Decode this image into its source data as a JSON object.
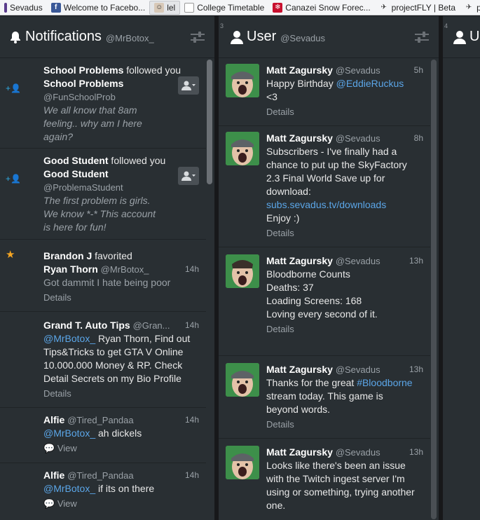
{
  "bookmarks": [
    {
      "label": "Sevadus",
      "icon": "sevadus-icon"
    },
    {
      "label": "Welcome to Facebo...",
      "icon": "facebook-icon"
    },
    {
      "label": "lel",
      "icon": "face-icon"
    },
    {
      "label": "College Timetable",
      "icon": "page-icon"
    },
    {
      "label": "Canazei Snow Forec...",
      "icon": "snow-forecast-icon"
    },
    {
      "label": "projectFLY | Beta",
      "icon": "plane-icon"
    },
    {
      "label": "p",
      "icon": "plane-icon"
    }
  ],
  "columns": {
    "notifications": {
      "title": "Notifications",
      "handle": "@MrBotox_",
      "number": "",
      "items": [
        {
          "type": "follow",
          "actor": "School Problems",
          "action": " followed you",
          "name": "School Problems",
          "handle": "@FunSchoolProb",
          "bio": [
            "We all know that 8am",
            "feeling.. why am I here",
            "again?"
          ]
        },
        {
          "type": "follow",
          "actor": "Good Student",
          "action": " followed you",
          "name": "Good Student",
          "handle": "@ProblemaStudent",
          "bio": [
            "The first problem is girls.",
            "We know *-* This account",
            "is here for fun!"
          ]
        },
        {
          "type": "favorite",
          "actor": "Brandon J",
          "action": " favorited",
          "name": "Ryan Thorn",
          "handle": "@MrBotox_",
          "time": "14h",
          "text": "Got dammit I hate being poor",
          "details": "Details"
        },
        {
          "type": "mention",
          "name": "Grand T. Auto Tips",
          "handle": "@Gran...",
          "time": "14h",
          "mention": "@MrBotox_",
          "lines": [
            " Ryan Thorn, Find out",
            "Tips&Tricks to get GTA V Online",
            "10.000.000 Money & RP. Check",
            "Detail Secrets on my Bio Profile"
          ],
          "details": "Details"
        },
        {
          "type": "reply",
          "name": "Alfie",
          "handle": "@Tired_Pandaa",
          "time": "14h",
          "mention": "@MrBotox_",
          "text": " ah dickels",
          "view": "View"
        },
        {
          "type": "reply",
          "name": "Alfie",
          "handle": "@Tired_Pandaa",
          "time": "14h",
          "mention": "@MrBotox_",
          "text": " if its on there",
          "view": "View"
        }
      ]
    },
    "user": {
      "title": "User",
      "handle": "@Sevadus",
      "number": "3",
      "tweets": [
        {
          "name": "Matt Zagursky",
          "handle": "@Sevadus",
          "time": "5h",
          "lines": [
            {
              "pre": "Happy Birthday ",
              "link": "@EddieRuckus"
            },
            {
              "pre": "<3"
            }
          ],
          "details": "Details"
        },
        {
          "name": "Matt Zagursky",
          "handle": "@Sevadus",
          "time": "8h",
          "lines": [
            {
              "pre": "Subscribers - I've finally had a"
            },
            {
              "pre": "chance to put up the SkyFactory"
            },
            {
              "pre": "2.3 Final World Save up for"
            },
            {
              "pre": "download:"
            },
            {
              "pre": "",
              "link": "subs.sevadus.tv/downloads"
            },
            {
              "pre": "Enjoy :)"
            }
          ],
          "details": "Details"
        },
        {
          "name": "Matt Zagursky",
          "handle": "@Sevadus",
          "time": "13h",
          "lines": [
            {
              "pre": "Bloodborne Counts"
            },
            {
              "pre": " "
            },
            {
              "pre": "Deaths: 37"
            },
            {
              "pre": "Loading Screens: 168"
            },
            {
              "pre": "Loving every second of it."
            }
          ],
          "details": "Details"
        },
        {
          "name": "Matt Zagursky",
          "handle": "@Sevadus",
          "time": "13h",
          "lines": [
            {
              "pre": "Thanks for the great ",
              "link": "#Bloodborne"
            },
            {
              "pre": "stream today. This game is"
            },
            {
              "pre": "beyond words."
            }
          ],
          "details": "Details"
        },
        {
          "name": "Matt Zagursky",
          "handle": "@Sevadus",
          "time": "13h",
          "lines": [
            {
              "pre": "Looks like there's been an issue"
            },
            {
              "pre": "with the Twitch ingest server I'm"
            },
            {
              "pre": "using or something, trying another"
            },
            {
              "pre": "one."
            }
          ],
          "details": ""
        }
      ]
    },
    "third": {
      "title": "U",
      "number": "4"
    }
  },
  "colors": {
    "column_bg": "#292f33",
    "link": "#5ba6e8",
    "star": "#f5a623",
    "follow_icon": "#2fa9e0",
    "avatar_bg": "#3d8f4a"
  }
}
